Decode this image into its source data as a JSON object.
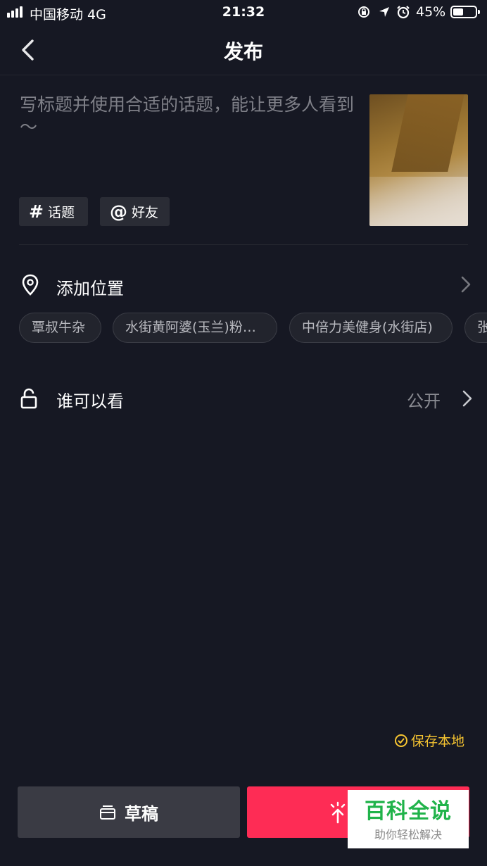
{
  "status_bar": {
    "carrier": "中国移动  4G",
    "time": "21:32",
    "battery_percent": "45%",
    "battery_level": 0.45,
    "icons": [
      "signal-icon",
      "rotation-lock-icon",
      "location-arrow-icon",
      "alarm-icon",
      "battery-icon"
    ]
  },
  "header": {
    "title": "发布",
    "back_icon": "chevron-left-icon"
  },
  "caption": {
    "placeholder": "写标题并使用合适的话题，能让更多人看到～"
  },
  "chips": {
    "topic_symbol": "#",
    "topic_label": "话题",
    "friend_symbol": "@",
    "friend_label": "好友"
  },
  "location": {
    "label": "添加位置",
    "suggestions": [
      "覃叔牛杂",
      "水街黄阿婆(玉兰)粉…",
      "中倍力美健身(水街店)",
      "张"
    ]
  },
  "visibility": {
    "label": "谁可以看",
    "value": "公开"
  },
  "save_local": {
    "label": "保存本地",
    "checked": true,
    "color": "#f7c531"
  },
  "actions": {
    "draft_label": "草稿",
    "publish_color": "#fe2c55"
  },
  "watermark": {
    "title": "百科全说",
    "subtitle": "助你轻松解决"
  },
  "colors": {
    "background": "#161823",
    "accent": "#fe2c55"
  }
}
